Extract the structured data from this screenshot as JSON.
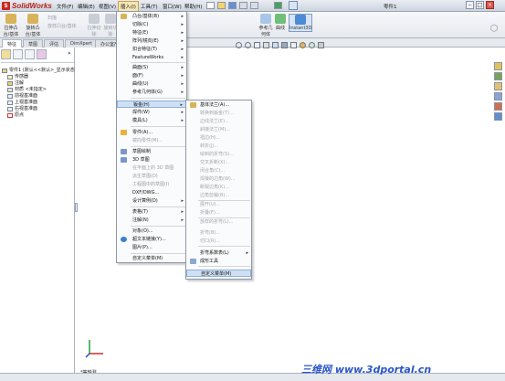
{
  "app": {
    "logo": "SolidWorks",
    "doc_title": "零件1"
  },
  "menubar": [
    "文件(F)",
    "编辑(E)",
    "视图(V)",
    "插入(I)",
    "工具(T)",
    "窗口(W)",
    "帮助(H)"
  ],
  "ribbon": {
    "buttons": [
      {
        "label": "拉伸凸台/基体"
      },
      {
        "label": "旋转凸台/基体"
      },
      {
        "label": "扫描"
      },
      {
        "label": "放样凸台/基体"
      },
      {
        "label": "拉伸切除"
      },
      {
        "label": "旋转切除"
      },
      {
        "label": "参考几何体"
      },
      {
        "label": "曲线"
      },
      {
        "label": "Instant3D"
      }
    ]
  },
  "tabs": [
    "特征",
    "草图",
    "评估",
    "DimXpert",
    "办公室产品"
  ],
  "tree": {
    "root": "零件1 (默认<<默认>_显示状态",
    "items": [
      "传感器",
      "注解",
      "材质 <未指定>",
      "前视基准面",
      "上视基准面",
      "右视基准面",
      "原点"
    ]
  },
  "insert_menu": {
    "items": [
      {
        "label": "凸台/基体(B)",
        "arrow": true
      },
      {
        "label": "切除(C)",
        "arrow": true
      },
      {
        "label": "特征(E)",
        "arrow": true
      },
      {
        "label": "阵列/镜向(E)",
        "arrow": true
      },
      {
        "label": "扣合特征(T)",
        "arrow": true
      },
      {
        "label": "FeatureWorks",
        "arrow": true
      },
      {
        "label": "曲面(S)",
        "arrow": true
      },
      {
        "label": "面(F)",
        "arrow": true
      },
      {
        "label": "曲线(U)",
        "arrow": true
      },
      {
        "label": "参考几何体(G)",
        "arrow": true
      },
      {
        "label": "钣金(H)",
        "arrow": true,
        "highlight": true
      },
      {
        "label": "焊件(W)",
        "arrow": true
      },
      {
        "label": "模具(L)",
        "arrow": true
      },
      {
        "label": "零件(A)...",
        "arrow": false
      },
      {
        "label": "镜向零件(M)...",
        "arrow": false,
        "disabled": true
      },
      {
        "label": "草图绘制",
        "arrow": false
      },
      {
        "label": "3D 草图",
        "arrow": false
      },
      {
        "label": "在平面上的 3D 草图",
        "arrow": false,
        "disabled": true
      },
      {
        "label": "派生草图(D)",
        "arrow": false,
        "disabled": true
      },
      {
        "label": "工程图中的草图(I)",
        "arrow": false,
        "disabled": true
      },
      {
        "label": "DXF/DWG...",
        "arrow": false
      },
      {
        "label": "设计算例(D)",
        "arrow": true
      },
      {
        "label": "表格(T)",
        "arrow": true
      },
      {
        "label": "注解(N)",
        "arrow": true
      },
      {
        "label": "对象(O)...",
        "arrow": false
      },
      {
        "label": "超文本链接(Y)...",
        "arrow": false
      },
      {
        "label": "图片(P)...",
        "arrow": false
      },
      {
        "label": "自定义菜单(M)",
        "arrow": false
      }
    ]
  },
  "sheetmetal_menu": {
    "items": [
      {
        "label": "基体法兰(A)...",
        "disabled": false
      },
      {
        "label": "转换到钣金(T)...",
        "disabled": true
      },
      {
        "label": "边线法兰(E)...",
        "disabled": true
      },
      {
        "label": "斜接法兰(M)...",
        "disabled": true
      },
      {
        "label": "褶边(H)...",
        "disabled": true
      },
      {
        "label": "转折(J)...",
        "disabled": true
      },
      {
        "label": "绘制的折弯(S)...",
        "disabled": true
      },
      {
        "label": "交叉折断(X)...",
        "disabled": true
      },
      {
        "label": "闭合角(C)...",
        "disabled": true
      },
      {
        "label": "焊接的边角(W)...",
        "disabled": true
      },
      {
        "label": "断裂边角(K)...",
        "disabled": true
      },
      {
        "label": "边角剪裁(B)...",
        "disabled": true
      },
      {
        "label": "展开(U)...",
        "disabled": true
      },
      {
        "label": "折叠(F)...",
        "disabled": true
      },
      {
        "label": "放样的折弯(L)...",
        "disabled": true
      },
      {
        "label": "折弯(B)...",
        "disabled": true
      },
      {
        "label": "切口(R)...",
        "disabled": true
      },
      {
        "label": "折弯系数表(L)",
        "disabled": false,
        "arrow": true
      },
      {
        "label": "成形工具",
        "disabled": false
      },
      {
        "label": "自定义菜单(M)",
        "disabled": false,
        "highlight": true
      }
    ]
  },
  "viewport": {
    "label": "*等轴测"
  },
  "watermark": "三维网 www.3dportal.cn",
  "colors": {
    "highlight": "#cfe0f5",
    "menu_border": "#8f98a6",
    "brand": "#c8281c",
    "watermark": "#2a55c8"
  }
}
